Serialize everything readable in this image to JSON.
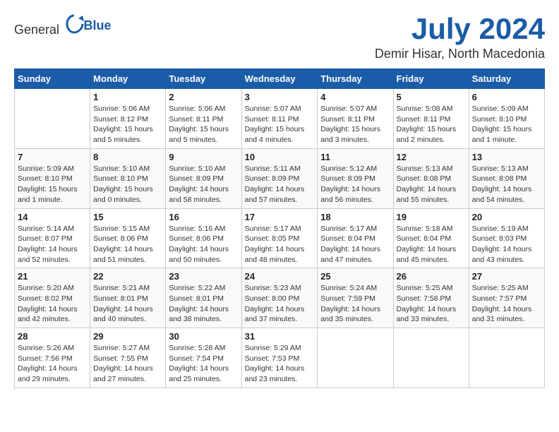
{
  "header": {
    "logo_general": "General",
    "logo_blue": "Blue",
    "month": "July 2024",
    "location": "Demir Hisar, North Macedonia"
  },
  "weekdays": [
    "Sunday",
    "Monday",
    "Tuesday",
    "Wednesday",
    "Thursday",
    "Friday",
    "Saturday"
  ],
  "weeks": [
    [
      {
        "day": "",
        "sunrise": "",
        "sunset": "",
        "daylight": ""
      },
      {
        "day": "1",
        "sunrise": "5:06 AM",
        "sunset": "8:12 PM",
        "daylight": "15 hours and 5 minutes."
      },
      {
        "day": "2",
        "sunrise": "5:06 AM",
        "sunset": "8:11 PM",
        "daylight": "15 hours and 5 minutes."
      },
      {
        "day": "3",
        "sunrise": "5:07 AM",
        "sunset": "8:11 PM",
        "daylight": "15 hours and 4 minutes."
      },
      {
        "day": "4",
        "sunrise": "5:07 AM",
        "sunset": "8:11 PM",
        "daylight": "15 hours and 3 minutes."
      },
      {
        "day": "5",
        "sunrise": "5:08 AM",
        "sunset": "8:11 PM",
        "daylight": "15 hours and 2 minutes."
      },
      {
        "day": "6",
        "sunrise": "5:09 AM",
        "sunset": "8:10 PM",
        "daylight": "15 hours and 1 minute."
      }
    ],
    [
      {
        "day": "7",
        "sunrise": "5:09 AM",
        "sunset": "8:10 PM",
        "daylight": "15 hours and 1 minute."
      },
      {
        "day": "8",
        "sunrise": "5:10 AM",
        "sunset": "8:10 PM",
        "daylight": "15 hours and 0 minutes."
      },
      {
        "day": "9",
        "sunrise": "5:10 AM",
        "sunset": "8:09 PM",
        "daylight": "14 hours and 58 minutes."
      },
      {
        "day": "10",
        "sunrise": "5:11 AM",
        "sunset": "8:09 PM",
        "daylight": "14 hours and 57 minutes."
      },
      {
        "day": "11",
        "sunrise": "5:12 AM",
        "sunset": "8:09 PM",
        "daylight": "14 hours and 56 minutes."
      },
      {
        "day": "12",
        "sunrise": "5:13 AM",
        "sunset": "8:08 PM",
        "daylight": "14 hours and 55 minutes."
      },
      {
        "day": "13",
        "sunrise": "5:13 AM",
        "sunset": "8:08 PM",
        "daylight": "14 hours and 54 minutes."
      }
    ],
    [
      {
        "day": "14",
        "sunrise": "5:14 AM",
        "sunset": "8:07 PM",
        "daylight": "14 hours and 52 minutes."
      },
      {
        "day": "15",
        "sunrise": "5:15 AM",
        "sunset": "8:06 PM",
        "daylight": "14 hours and 51 minutes."
      },
      {
        "day": "16",
        "sunrise": "5:16 AM",
        "sunset": "8:06 PM",
        "daylight": "14 hours and 50 minutes."
      },
      {
        "day": "17",
        "sunrise": "5:17 AM",
        "sunset": "8:05 PM",
        "daylight": "14 hours and 48 minutes."
      },
      {
        "day": "18",
        "sunrise": "5:17 AM",
        "sunset": "8:04 PM",
        "daylight": "14 hours and 47 minutes."
      },
      {
        "day": "19",
        "sunrise": "5:18 AM",
        "sunset": "8:04 PM",
        "daylight": "14 hours and 45 minutes."
      },
      {
        "day": "20",
        "sunrise": "5:19 AM",
        "sunset": "8:03 PM",
        "daylight": "14 hours and 43 minutes."
      }
    ],
    [
      {
        "day": "21",
        "sunrise": "5:20 AM",
        "sunset": "8:02 PM",
        "daylight": "14 hours and 42 minutes."
      },
      {
        "day": "22",
        "sunrise": "5:21 AM",
        "sunset": "8:01 PM",
        "daylight": "14 hours and 40 minutes."
      },
      {
        "day": "23",
        "sunrise": "5:22 AM",
        "sunset": "8:01 PM",
        "daylight": "14 hours and 38 minutes."
      },
      {
        "day": "24",
        "sunrise": "5:23 AM",
        "sunset": "8:00 PM",
        "daylight": "14 hours and 37 minutes."
      },
      {
        "day": "25",
        "sunrise": "5:24 AM",
        "sunset": "7:59 PM",
        "daylight": "14 hours and 35 minutes."
      },
      {
        "day": "26",
        "sunrise": "5:25 AM",
        "sunset": "7:58 PM",
        "daylight": "14 hours and 33 minutes."
      },
      {
        "day": "27",
        "sunrise": "5:25 AM",
        "sunset": "7:57 PM",
        "daylight": "14 hours and 31 minutes."
      }
    ],
    [
      {
        "day": "28",
        "sunrise": "5:26 AM",
        "sunset": "7:56 PM",
        "daylight": "14 hours and 29 minutes."
      },
      {
        "day": "29",
        "sunrise": "5:27 AM",
        "sunset": "7:55 PM",
        "daylight": "14 hours and 27 minutes."
      },
      {
        "day": "30",
        "sunrise": "5:28 AM",
        "sunset": "7:54 PM",
        "daylight": "14 hours and 25 minutes."
      },
      {
        "day": "31",
        "sunrise": "5:29 AM",
        "sunset": "7:53 PM",
        "daylight": "14 hours and 23 minutes."
      },
      {
        "day": "",
        "sunrise": "",
        "sunset": "",
        "daylight": ""
      },
      {
        "day": "",
        "sunrise": "",
        "sunset": "",
        "daylight": ""
      },
      {
        "day": "",
        "sunrise": "",
        "sunset": "",
        "daylight": ""
      }
    ]
  ],
  "labels": {
    "sunrise": "Sunrise:",
    "sunset": "Sunset:",
    "daylight": "Daylight:"
  }
}
